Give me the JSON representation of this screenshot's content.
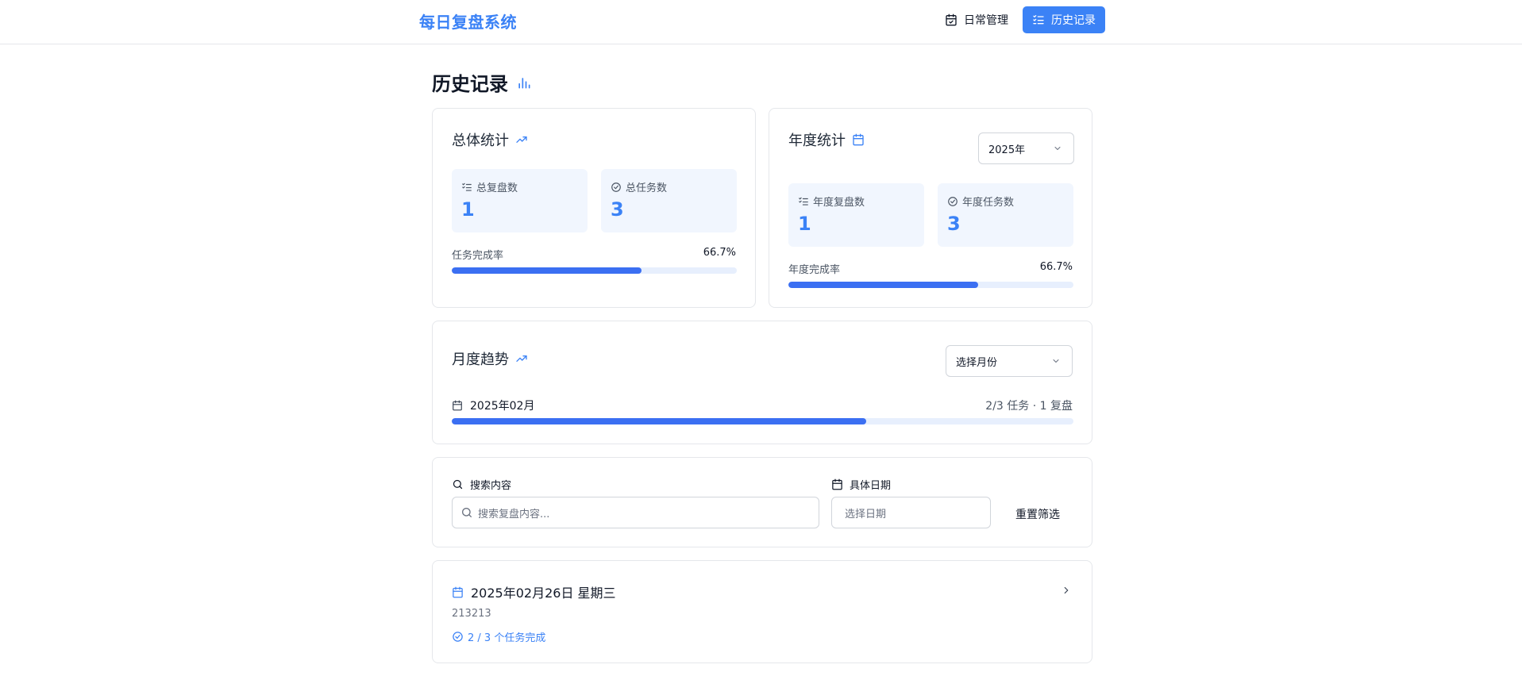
{
  "app": {
    "title": "每日复盘系统"
  },
  "nav": {
    "daily_label": "日常管理",
    "history_label": "历史记录"
  },
  "page": {
    "title": "历史记录"
  },
  "overall": {
    "title": "总体统计",
    "total_reviews_label": "总复盘数",
    "total_reviews": "1",
    "total_tasks_label": "总任务数",
    "total_tasks": "3",
    "rate_label": "任务完成率",
    "rate_text": "66.7%",
    "rate_fraction": 0.667
  },
  "yearly": {
    "title": "年度统计",
    "year_selected": "2025年",
    "reviews_label": "年度复盘数",
    "reviews": "1",
    "tasks_label": "年度任务数",
    "tasks": "3",
    "rate_label": "年度完成率",
    "rate_text": "66.7%",
    "rate_fraction": 0.667
  },
  "monthly": {
    "title": "月度趋势",
    "month_placeholder": "选择月份",
    "month_label": "2025年02月",
    "month_summary": "2/3 任务 · 1 复盘",
    "month_fraction": 0.667
  },
  "filters": {
    "search_label": "搜索内容",
    "search_placeholder": "搜索复盘内容...",
    "date_label": "具体日期",
    "date_placeholder": "选择日期",
    "reset_label": "重置筛选"
  },
  "records": [
    {
      "date": "2025年02月26日 星期三",
      "content": "213213",
      "tasks": "2 / 3 个任务完成"
    }
  ],
  "colors": {
    "accent": "#3b82f6",
    "stat_bg": "#f1f6fe",
    "track": "#e7effd"
  },
  "icons": {
    "nav_daily": "calendar-check-icon",
    "nav_history": "list-checks-icon",
    "page_title": "bar-chart-icon",
    "overall": "trending-up-icon",
    "yearly": "calendar-icon",
    "monthly": "trending-up-icon",
    "search": "search-icon",
    "date": "calendar-icon",
    "record_date": "calendar-icon",
    "record_tasks": "check-circle-icon",
    "record_open": "chevron-right-icon"
  }
}
